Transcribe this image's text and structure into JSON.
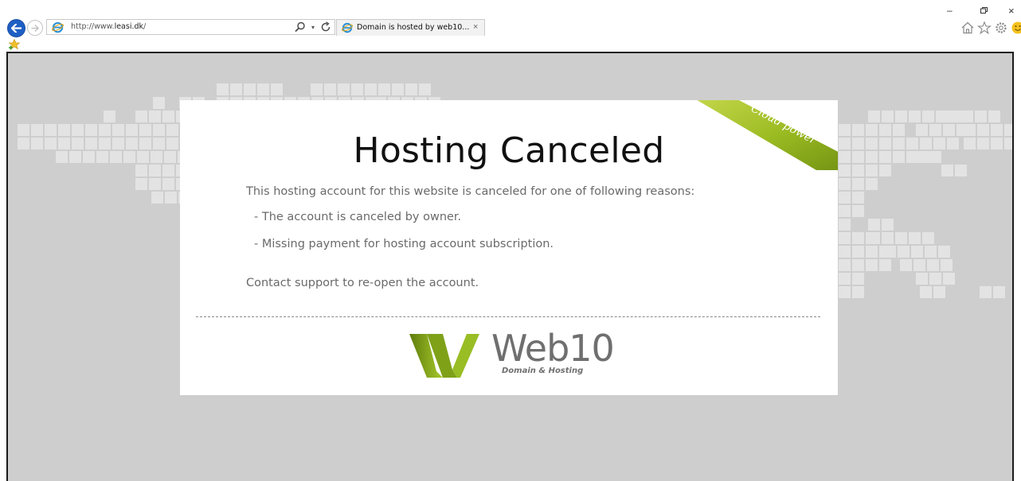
{
  "browser": {
    "address_prefix": "http://www.",
    "address_domain": "leasi.dk",
    "address_suffix": "/",
    "tab_title": "Domain is hosted by web10...",
    "tab_close": "×",
    "minimize": "–",
    "close": "×"
  },
  "page": {
    "title": "Hosting Canceled",
    "intro": "This hosting account for this website is canceled for one of following reasons:",
    "reasons": [
      "- The account is canceled by owner.",
      "- Missing payment for hosting account subscription."
    ],
    "contact": "Contact support to re-open the account.",
    "ribbon": "Cloud power",
    "logo_name": "Web10",
    "logo_tagline": "Domain & Hosting"
  },
  "colors": {
    "viewport_bg": "#cecece",
    "map_tile": "#e3e3e3",
    "ribbon": "#8fb31c",
    "logo_green": "#8cb51a",
    "back_button": "#1e5fc4"
  }
}
